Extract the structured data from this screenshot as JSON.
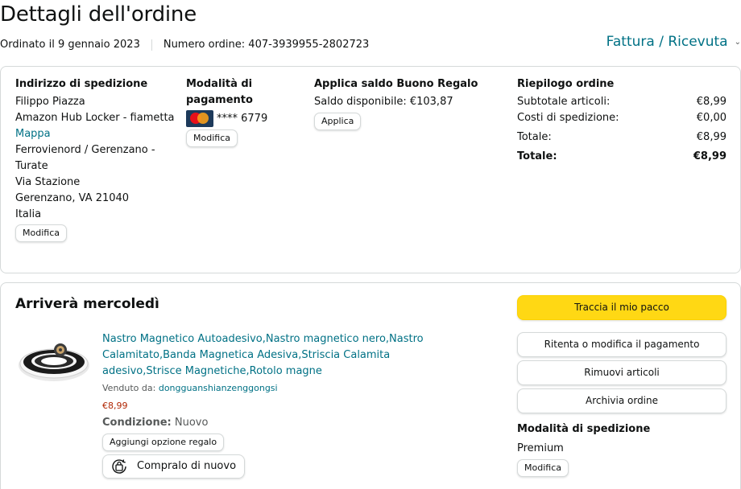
{
  "header": {
    "title": "Dettagli dell'ordine",
    "ordered": "Ordinato il 9 gennaio 2023",
    "order_number": "Numero ordine: 407-3939955-2802723",
    "invoice_label": "Fattura / Ricevuta"
  },
  "shipping_address": {
    "heading": "Indirizzo di spedizione",
    "name": "Filippo Piazza",
    "line1": "Amazon Hub Locker - fiametta",
    "map_link": "Mappa",
    "line2": "Ferrovienord / Gerenzano -",
    "line3": "Turate",
    "line4": "Via Stazione",
    "line5": "Gerenzano, VA 21040",
    "country": "Italia",
    "edit_label": "Modifica"
  },
  "payment": {
    "heading_l1": "Modalità di",
    "heading_l2": "pagamento",
    "card_icon": "mastercard-icon",
    "card_digits": "**** 6779",
    "edit_label": "Modifica"
  },
  "gift": {
    "heading": "Applica saldo Buono Regalo",
    "balance": "Saldo disponibile: €103,87",
    "apply_label": "Applica"
  },
  "summary": {
    "heading": "Riepilogo ordine",
    "rows": [
      {
        "label": "Subtotale articoli:",
        "value": "€8,99"
      },
      {
        "label": "Costi di spedizione:",
        "value": "€0,00"
      },
      {
        "label": "Totale:",
        "value": "€8,99"
      },
      {
        "label": "Totale:",
        "value": "€8,99"
      }
    ]
  },
  "shipment": {
    "arrives": "Arriverà mercoledì",
    "product": {
      "image_icon": "magnetic-tape-roll-image",
      "title": "Nastro Magnetico Autoadesivo,Nastro magnetico nero,Nastro Calamitato,Banda Magnetica Adesiva,Striscia Calamita adesivo,Strisce Magnetiche,Rotolo magne",
      "sold_by_label": "Venduto da:",
      "seller": "dongguanshianzenggongsi",
      "price": "€8,99",
      "condition_label": "Condizione:",
      "condition_value": "Nuovo",
      "gift_option_label": "Aggiungi opzione regalo",
      "buy_again_label": "Compralo di nuovo",
      "buy_again_icon": "buy-again-icon"
    },
    "actions": {
      "track": "Traccia il mio pacco",
      "retry_payment": "Ritenta o modifica il pagamento",
      "remove_items": "Rimuovi articoli",
      "archive": "Archivia ordine"
    },
    "shipping_method": {
      "heading": "Modalità di spedizione",
      "value": "Premium",
      "edit_label": "Modifica"
    }
  },
  "colors": {
    "link": "#007185",
    "price": "#b12704",
    "track_button": "#ffd814",
    "border": "#d5d9d9"
  }
}
